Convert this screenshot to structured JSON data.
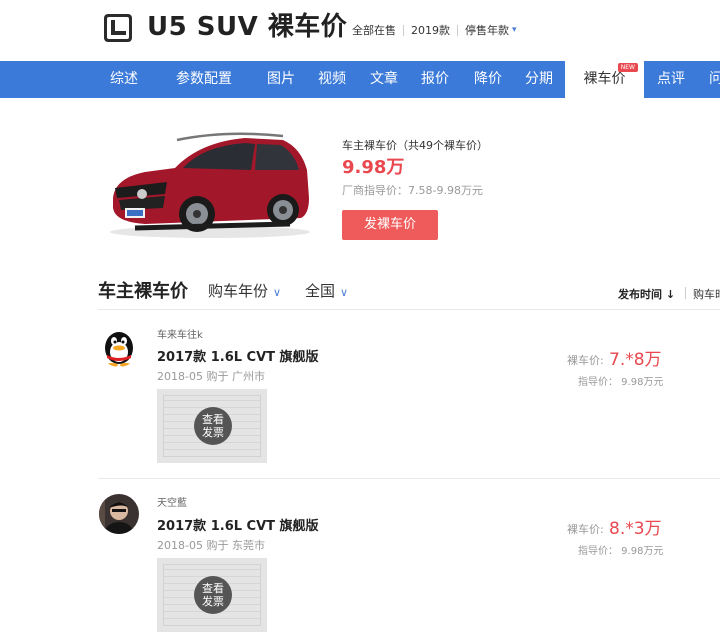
{
  "header": {
    "title": "U5 SUV 裸车价",
    "filters": [
      "全部在售",
      "2019款",
      "停售年款"
    ]
  },
  "nav": {
    "items": [
      "综述",
      "参数配置",
      "图片",
      "视频",
      "文章",
      "报价",
      "降价",
      "分期",
      "裸车价",
      "点评",
      "问"
    ],
    "active": "裸车价",
    "new_badge": "NEW",
    "colors": {
      "bar": "#3b7ad9",
      "accent": "#e9484f"
    }
  },
  "summary": {
    "label": "车主裸车价（共49个裸车价）",
    "price": "9.98万",
    "guide": "厂商指导价：7.58-9.98万元",
    "button": "发裸车价"
  },
  "section": {
    "title": "车主裸车价",
    "filter_year": "购车年份",
    "filter_region": "全国",
    "sort_time": "发布时间",
    "sort_arrow": "↓",
    "sort_other": "购车时"
  },
  "entries": [
    {
      "user": "车来车往k",
      "model": "2017款 1.6L CVT 旗舰版",
      "meta": "2018-05 购于 广州市",
      "invoice_label": "查看发票",
      "price_label": "裸车价:",
      "price": "7.*8万",
      "guide": "指导价： 9.98万元",
      "avatar_icon": "qq-penguin-icon"
    },
    {
      "user": "天空藍",
      "model": "2017款 1.6L CVT 旗舰版",
      "meta": "2018-05 购于 东莞市",
      "invoice_label": "查看发票",
      "price_label": "裸车价:",
      "price": "8.*3万",
      "guide": "指导价： 9.98万元",
      "avatar_icon": "user-photo-icon"
    }
  ]
}
